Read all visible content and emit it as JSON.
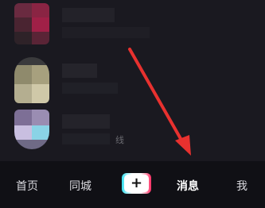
{
  "message_list": {
    "items": [
      {
        "kind": "conversation"
      },
      {
        "kind": "conversation"
      },
      {
        "kind": "conversation",
        "status_text": "线"
      }
    ]
  },
  "tab_bar": {
    "home_label": "首页",
    "nearby_label": "同城",
    "create_label": "+",
    "messages_label": "消息",
    "me_label": "我",
    "active_tab": "消息"
  },
  "annotation": {
    "arrow_color": "#e8312f"
  },
  "colors": {
    "background": "#151419",
    "tab_bar_bg": "#101015",
    "accent_cyan": "#35e0f0",
    "accent_pink": "#ff2e63"
  }
}
